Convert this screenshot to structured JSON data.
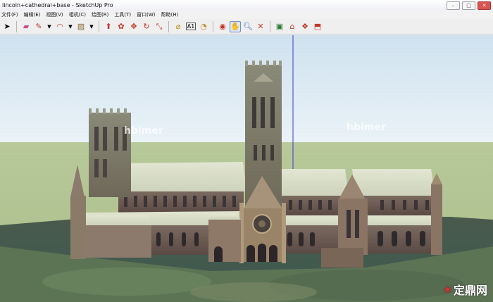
{
  "window": {
    "title": "lincoln+cathedral+base - SketchUp Pro"
  },
  "menu": [
    "文件(F)",
    "编辑(E)",
    "视图(V)",
    "相机(C)",
    "绘图(R)",
    "工具(T)",
    "窗口(W)",
    "帮助(H)"
  ],
  "toolbar": {
    "tools": [
      {
        "name": "select",
        "icon": "arrow-icon"
      },
      {
        "name": "eraser",
        "icon": "eraser-icon"
      },
      {
        "name": "pencil",
        "icon": "pencil-icon"
      },
      {
        "name": "arc",
        "icon": "arc-icon"
      },
      {
        "name": "rectangle",
        "icon": "rectangle-icon"
      },
      {
        "name": "push-pull",
        "icon": "pushpull-icon"
      },
      {
        "name": "follow-me",
        "icon": "followme-icon"
      },
      {
        "name": "move",
        "icon": "move-icon"
      },
      {
        "name": "rotate",
        "icon": "rotate-icon"
      },
      {
        "name": "scale",
        "icon": "scale-icon"
      },
      {
        "name": "paint-bucket",
        "icon": "paint-icon"
      },
      {
        "name": "tape-measure",
        "icon": "tape-icon"
      },
      {
        "name": "text",
        "icon": "text-icon"
      },
      {
        "name": "orbit",
        "icon": "orbit-icon"
      },
      {
        "name": "pan",
        "icon": "pan-icon"
      },
      {
        "name": "zoom",
        "icon": "zoom-icon"
      },
      {
        "name": "zoom-extents",
        "icon": "zoom-extents-icon"
      },
      {
        "name": "components",
        "icon": "components-icon"
      },
      {
        "name": "warehouse",
        "icon": "warehouse-icon"
      },
      {
        "name": "share-model",
        "icon": "share-icon"
      }
    ]
  },
  "watermark": {
    "left": "hbimer",
    "right": "hbimer",
    "corner": "定鼎网"
  }
}
